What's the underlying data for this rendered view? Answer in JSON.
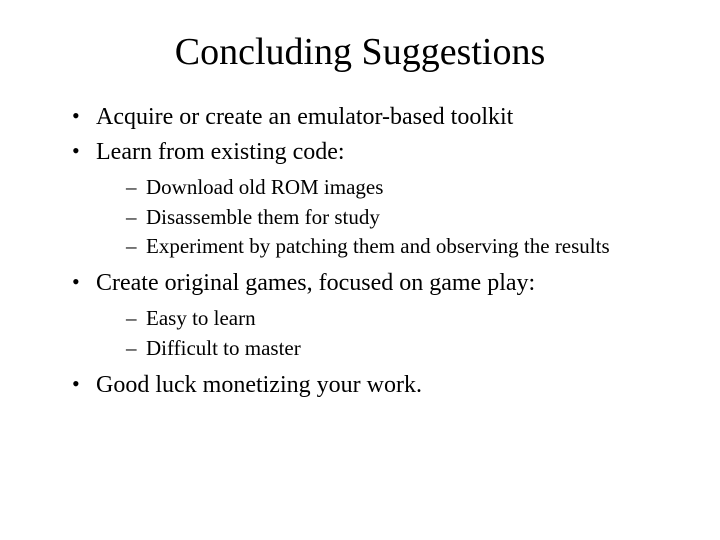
{
  "title": "Concluding Suggestions",
  "bullets": [
    {
      "text": "Acquire or create an emulator-based toolkit",
      "sub": []
    },
    {
      "text": "Learn from existing code:",
      "sub": [
        "Download old ROM images",
        "Disassemble them for study",
        "Experiment by patching them and observing the results"
      ]
    },
    {
      "text": "Create original games, focused on game play:",
      "sub": [
        "Easy to learn",
        "Difficult to master"
      ]
    },
    {
      "text": "Good luck monetizing your work.",
      "sub": []
    }
  ]
}
